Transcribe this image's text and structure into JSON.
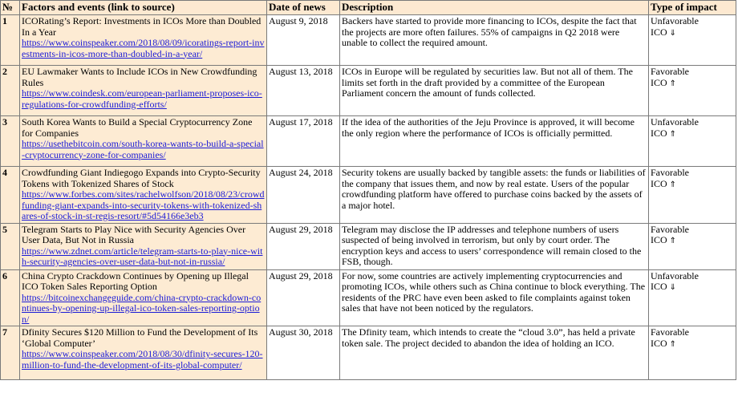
{
  "table": {
    "headers": {
      "num": "№",
      "factors": "Factors and events (link to source)",
      "date": "Date of news",
      "description": "Description",
      "impact": "Type of impact"
    },
    "rows": [
      {
        "num": "1",
        "title": "ICORating’s Report: Investments in ICOs More than Doubled In a Year",
        "link": "https://www.coinspeaker.com/2018/08/09/icoratings-report-investments-in-icos-more-than-doubled-in-a-year/",
        "date": "August 9, 2018",
        "description": "Backers have started to provide more financing to ICOs, despite the fact that the projects are more often failures. 55% of campaigns in Q2 2018 were unable to collect the required amount.",
        "impact": "Unfavorable",
        "impact_line2": "ICO",
        "arrow": "⇓"
      },
      {
        "num": "2",
        "title": "EU Lawmaker Wants to Include ICOs in New Crowdfunding Rules",
        "link": "https://www.coindesk.com/european-parliament-proposes-ico-regulations-for-crowdfunding-efforts/",
        "date": "August 13, 2018",
        "description": "ICOs in Europe will be regulated by securities law. But not all of them. The limits set forth in the draft provided by a committee of the European Parliament concern the amount of funds collected.",
        "impact": "Favorable",
        "impact_line2": "ICO",
        "arrow": "⇑"
      },
      {
        "num": "3",
        "title": "South Korea Wants to Build a Special Cryptocurrency Zone for Companies",
        "link": "https://usethebitcoin.com/south-korea-wants-to-build-a-special-cryptocurrency-zone-for-companies/",
        "date": "August 17, 2018",
        "description": "If the idea of the authorities of the Jeju Province is approved, it will become the only region where the performance of ICOs is officially permitted.",
        "impact": "Unfavorable",
        "impact_line2": "ICO",
        "arrow": "⇑"
      },
      {
        "num": "4",
        "title": "Crowdfunding Giant Indiegogo Expands into Crypto-Security Tokens with Tokenized Shares of Stock",
        "link": "https://www.forbes.com/sites/rachelwolfson/2018/08/23/crowdfunding-giant-expands-into-security-tokens-with-tokenized-shares-of-stock-in-st-regis-resort/#5d54166e3eb3",
        "date": "August 24, 2018",
        "description": "Security tokens are usually backed by tangible assets: the funds or liabilities of the company that issues them, and now by real estate. Users of the popular crowdfunding platform have offered to purchase coins backed by the assets of a major hotel.",
        "impact": "Favorable",
        "impact_line2": "ICO",
        "arrow": "⇑"
      },
      {
        "num": "5",
        "title": "Telegram Starts to Play Nice with Security Agencies Over User Data, But Not in Russia",
        "link": "https://www.zdnet.com/article/telegram-starts-to-play-nice-with-security-agencies-over-user-data-but-not-in-russia/",
        "date": "August 29, 2018",
        "description": "Telegram may disclose the IP addresses and telephone numbers of users suspected of being involved in terrorism, but only by court order. The encryption keys and access to users’ correspondence will remain closed to the FSB, though.",
        "impact": "Favorable",
        "impact_line2": "ICO",
        "arrow": "⇑"
      },
      {
        "num": "6",
        "title": "China Crypto Crackdown Continues by Opening up Illegal ICO Token Sales Reporting Option",
        "link": "https://bitcoinexchangeguide.com/china-crypto-crackdown-continues-by-opening-up-illegal-ico-token-sales-reporting-option/",
        "date": "August 29, 2018",
        "description": "For now, some countries are actively implementing cryptocurrencies and promoting ICOs, while others such as China continue to block everything. The residents of the PRC have even been asked to file complaints against token sales that have not been noticed by the regulators.",
        "impact": "Unfavorable",
        "impact_line2": "ICO",
        "arrow": "⇓"
      },
      {
        "num": "7",
        "title": "Dfinity Secures $120 Million to Fund the Development of Its ‘Global Computer’",
        "link": "https://www.coinspeaker.com/2018/08/30/dfinity-secures-120-million-to-fund-the-development-of-its-global-computer/",
        "date": "August 30, 2018",
        "description": "The Dfinity team, which intends to create the “cloud 3.0”, has held a private token sale. The project decided to abandon the idea of holding an ICO.",
        "impact": "Favorable",
        "impact_line2": "ICO",
        "arrow": "⇑"
      }
    ]
  }
}
